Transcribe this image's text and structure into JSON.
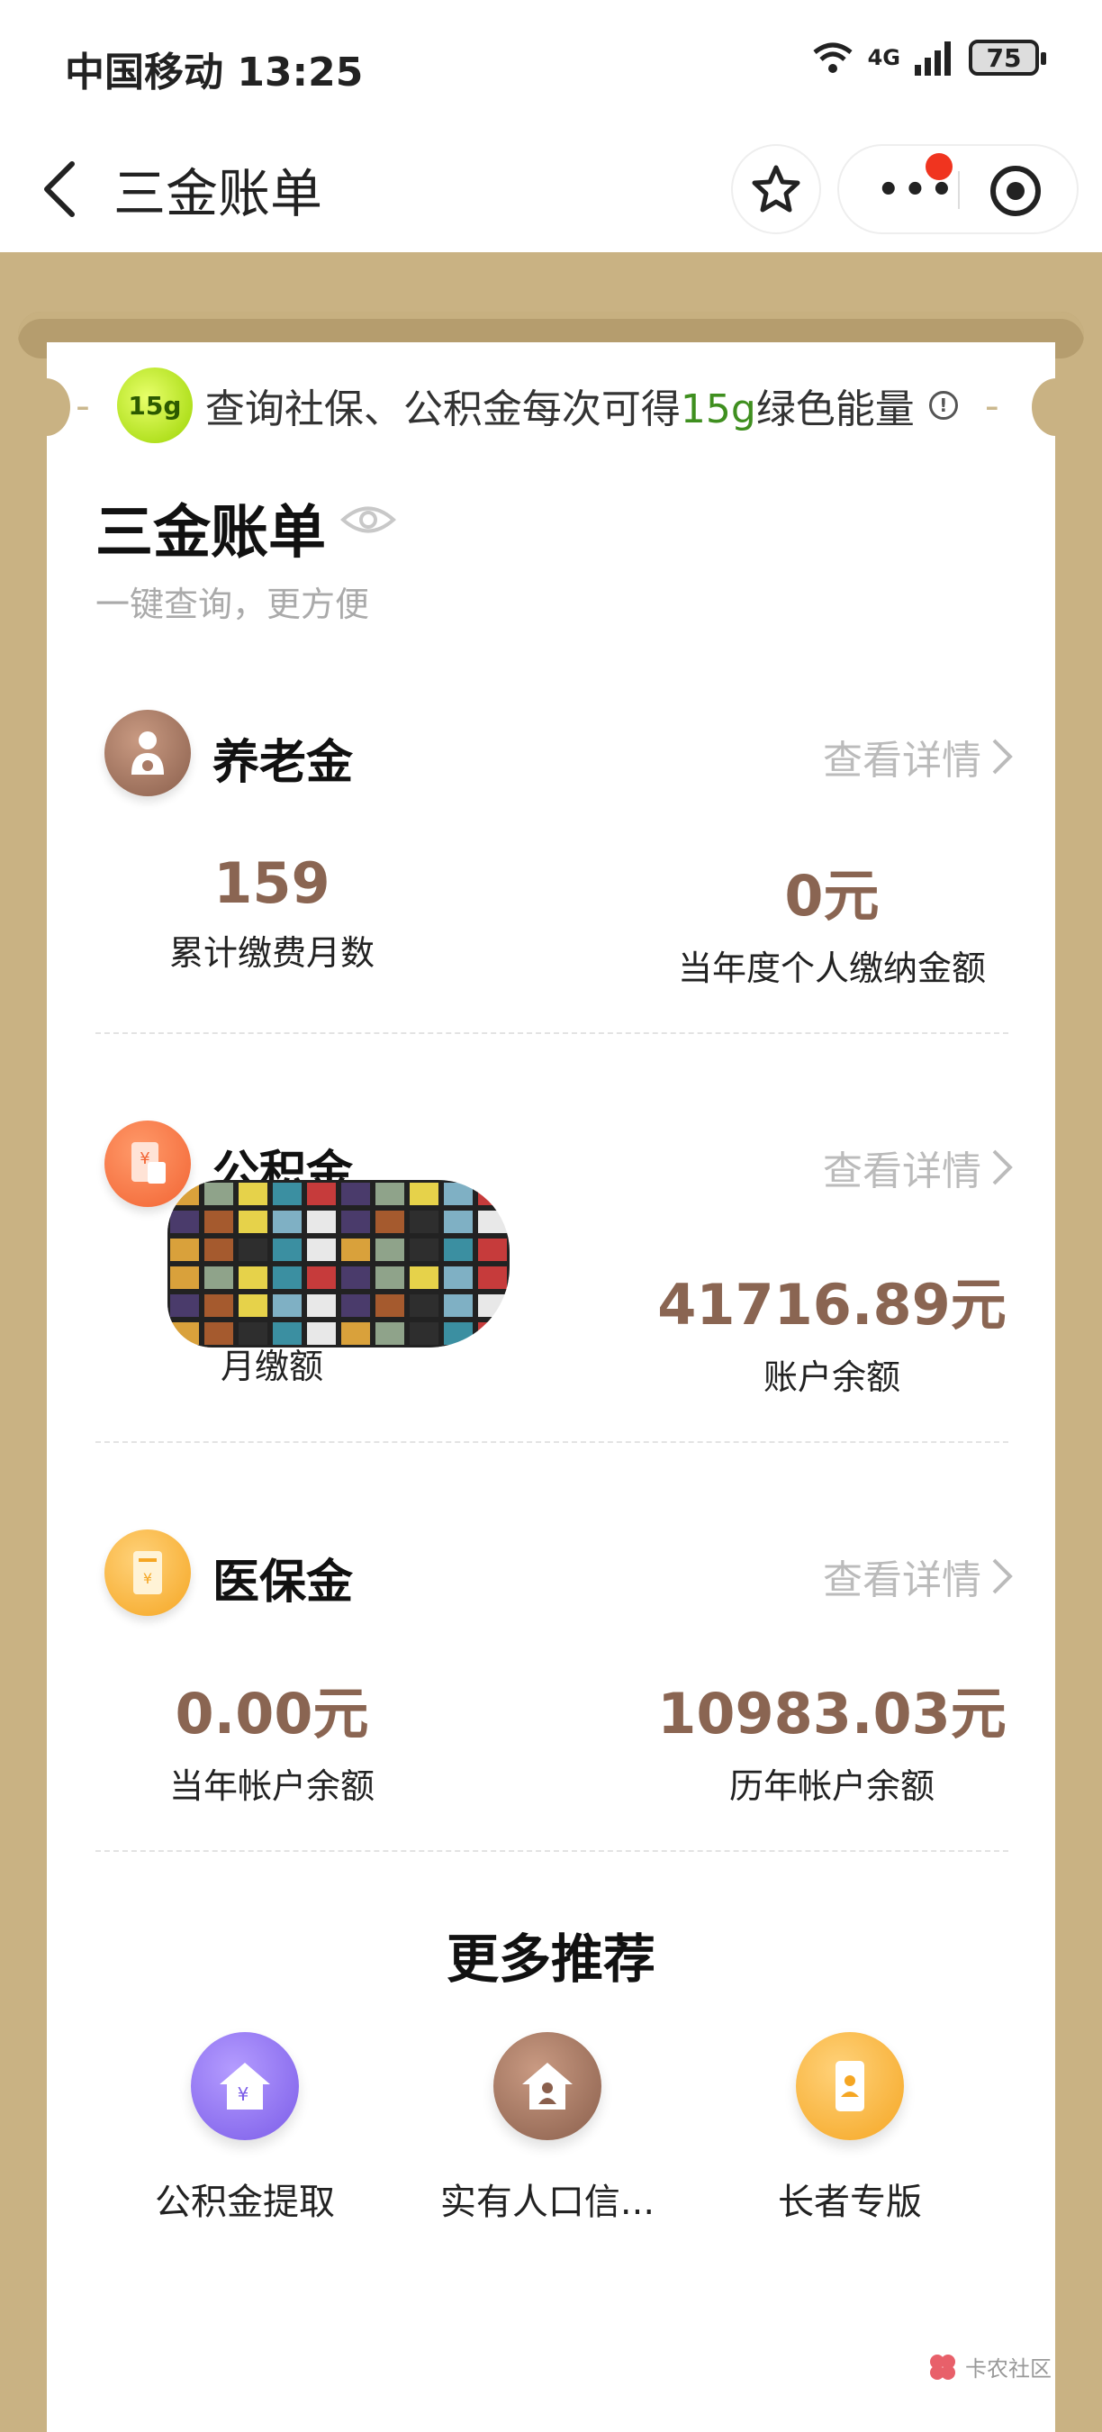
{
  "status_bar": {
    "carrier_time": "中国移动 13:25",
    "signal": "4G",
    "battery": "75"
  },
  "nav": {
    "title": "三金账单"
  },
  "banner": {
    "text_before": "查询社保、公积金每次可得",
    "highlight": "15g",
    "text_after": "绿色能量",
    "badge": "15g"
  },
  "header": {
    "title": "三金账单",
    "subtitle": "一键查询，更方便"
  },
  "pension": {
    "title": "养老金",
    "link": "查看详情",
    "stats": [
      {
        "value": "159",
        "label": "累计缴费月数"
      },
      {
        "value": "0元",
        "label": "当年度个人缴纳金额"
      }
    ]
  },
  "housing_fund": {
    "title": "公积金",
    "link": "查看详情",
    "stats": [
      {
        "value": "",
        "label": "月缴额"
      },
      {
        "value": "41716.89元",
        "label": "账户余额"
      }
    ]
  },
  "medical": {
    "title": "医保金",
    "link": "查看详情",
    "stats": [
      {
        "value": "0.00元",
        "label": "当年帐户余额"
      },
      {
        "value": "10983.03元",
        "label": "历年帐户余额"
      }
    ]
  },
  "more": {
    "title": "更多推荐",
    "items": [
      {
        "label": "公积金提取"
      },
      {
        "label": "实有人口信..."
      },
      {
        "label": "长者专版"
      }
    ]
  },
  "watermark": "卡农社区",
  "colors": {
    "accent_brown": "#8a6552",
    "frame": "#c9b283",
    "energy_green": "#3f8f1f",
    "notification_red": "#f0341f"
  }
}
